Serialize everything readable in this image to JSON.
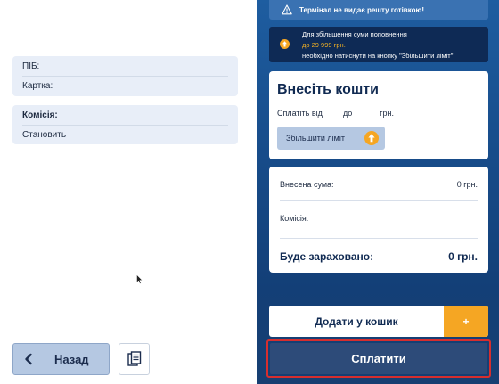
{
  "left_panel": {
    "card1": {
      "name_label": "ПІБ:",
      "card_label": "Картка:"
    },
    "card2": {
      "commission_label": "Комісія:",
      "commission_value": "Становить"
    },
    "back_label": "Назад",
    "icons": {
      "back": "chevron-left-icon",
      "copy": "copy-icon"
    }
  },
  "right_panel": {
    "warning": "Термінал не видає решту готівкою!",
    "limit_info": {
      "line1": "Для збільшення суми поповнення",
      "line2": "до 29 999 грн.",
      "line3": "необхідно натиснути на кнопку \"Збільшити ліміт\""
    },
    "deposit": {
      "title": "Внесіть кошти",
      "from": "Сплатіть від",
      "to": "до",
      "currency": "грн.",
      "limit_button": "Збільшити ліміт"
    },
    "summary": {
      "deposited_label": "Внесена сума:",
      "deposited_value": "0 грн.",
      "commission_label": "Комісія:",
      "commission_value": "",
      "total_label": "Буде зараховано:",
      "total_value": "0 грн."
    },
    "cart_button": "Додати у кошик",
    "cart_plus": "+",
    "pay_button": "Сплатити"
  },
  "colors": {
    "panel_blue": "#1e5da0",
    "accent_orange": "#f5a623",
    "highlight_red": "#d72e2e"
  }
}
